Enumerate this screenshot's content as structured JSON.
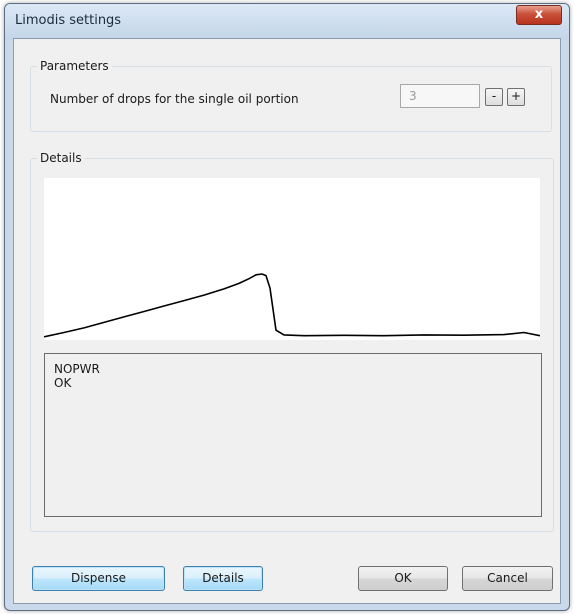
{
  "window": {
    "title": "Limodis settings",
    "close_symbol": "x"
  },
  "parameters": {
    "group_label": "Parameters",
    "drops_label": "Number of drops for the single oil portion",
    "drops_value": "3",
    "decrement_label": "-",
    "increment_label": "+"
  },
  "details": {
    "group_label": "Details",
    "log_lines": [
      "NOPWR",
      "OK"
    ]
  },
  "chart_data": {
    "type": "line",
    "title": "",
    "xlabel": "",
    "ylabel": "",
    "grid": false,
    "series": [
      {
        "color": "#000000",
        "x": [
          0,
          20,
          40,
          60,
          80,
          100,
          120,
          140,
          160,
          180,
          195,
          205,
          212,
          218,
          222,
          226,
          232,
          240,
          260,
          300,
          340,
          380,
          420,
          460,
          480,
          496
        ],
        "y": [
          0.8,
          3.5,
          6.5,
          10,
          13.5,
          17,
          20.5,
          24,
          27.5,
          31.5,
          35,
          38,
          40.5,
          41,
          40,
          32,
          5,
          2,
          1.5,
          1.7,
          1.5,
          2,
          1.8,
          2.2,
          3.5,
          1.5
        ]
      }
    ],
    "xlim": [
      0,
      496
    ],
    "ylim": [
      0,
      100
    ]
  },
  "buttons": {
    "dispense": "Dispense",
    "details": "Details",
    "ok": "OK",
    "cancel": "Cancel"
  },
  "icons": {
    "close": "close-icon"
  }
}
